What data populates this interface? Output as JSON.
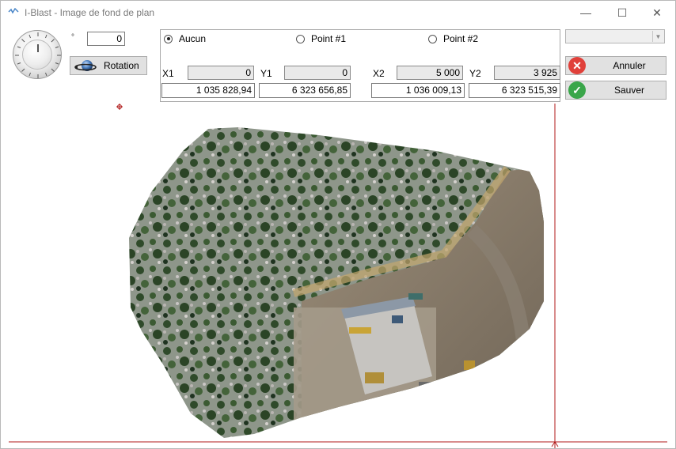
{
  "window": {
    "title": "I-Blast - Image de fond de plan",
    "minimize_glyph": "—",
    "maximize_glyph": "☐",
    "close_glyph": "✕"
  },
  "rotation": {
    "degree_symbol": "°",
    "angle_value": "0",
    "button_label": "Rotation"
  },
  "points": {
    "radios": [
      {
        "label": "Aucun",
        "checked": true
      },
      {
        "label": "Point #1",
        "checked": false
      },
      {
        "label": "Point #2",
        "checked": false
      }
    ],
    "labels": {
      "x1": "X1",
      "y1": "Y1",
      "x2": "X2",
      "y2": "Y2"
    },
    "image_coords": {
      "x1": "0",
      "y1": "0",
      "x2": "5 000",
      "y2": "3 925"
    },
    "world_coords": {
      "x1": "1 035 828,94",
      "y1": "6 323 656,85",
      "x2": "1 036 009,13",
      "y2": "6 323 515,39"
    }
  },
  "combo": {
    "value": ""
  },
  "actions": {
    "cancel_label": "Annuler",
    "save_label": "Sauver",
    "cancel_color": "#e0403a",
    "save_color": "#3aa64a"
  },
  "colors": {
    "crosshair": "#b01a1a"
  },
  "icons": [
    "app-icon",
    "rotation-icon",
    "cancel-icon",
    "save-icon",
    "minimize-icon",
    "maximize-icon",
    "close-icon",
    "dropdown-arrow-icon"
  ]
}
